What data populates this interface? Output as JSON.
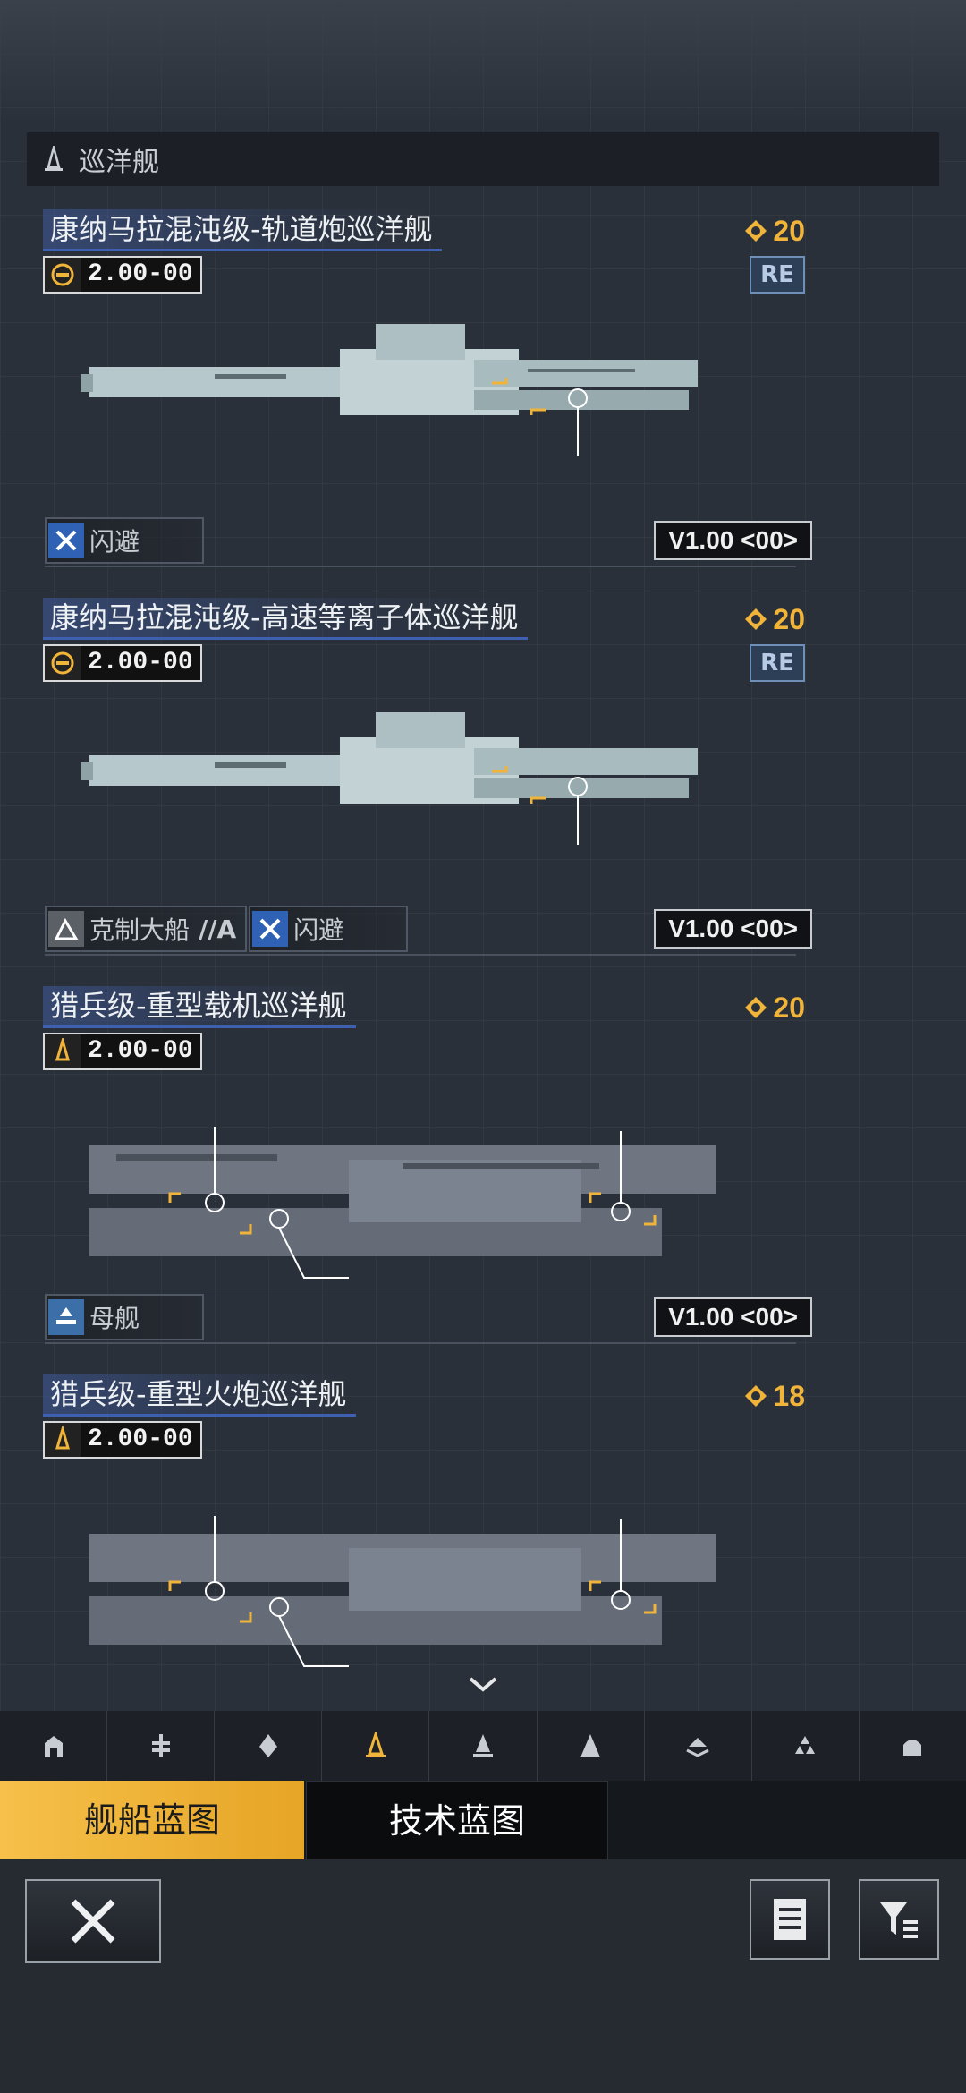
{
  "section": {
    "title": "巡洋舰"
  },
  "ships": [
    {
      "name": "康纳马拉混沌级-轨道炮巡洋舰",
      "cost": "20",
      "stat": "2.00-00",
      "badge": "RE",
      "tags": [
        {
          "label": "闪避",
          "icon": "dodge-icon"
        }
      ],
      "version": "V1.00 <00>"
    },
    {
      "name": "康纳马拉混沌级-高速等离子体巡洋舰",
      "cost": "20",
      "stat": "2.00-00",
      "badge": "RE",
      "tags": [
        {
          "label": "克制大船",
          "suffix": "//A",
          "icon": "counter-large-icon"
        },
        {
          "label": "闪避",
          "icon": "dodge-icon"
        }
      ],
      "version": "V1.00 <00>"
    },
    {
      "name": "猎兵级-重型载机巡洋舰",
      "cost": "20",
      "stat": "2.00-00",
      "tags": [
        {
          "label": "母舰",
          "icon": "carrier-icon"
        }
      ],
      "version": "V1.00 <00>"
    },
    {
      "name": "猎兵级-重型火炮巡洋舰",
      "cost": "18",
      "stat": "2.00-00"
    }
  ],
  "categories": [
    "fighter-icon",
    "corvette-icon",
    "frigate-icon",
    "cruiser-icon",
    "destroyer-icon",
    "battlecruiser-icon",
    "carrier-icon",
    "battleship-icon",
    "auxiliary-icon"
  ],
  "active_category": "cruiser-icon",
  "tabs": {
    "ship_blueprint": "舰船蓝图",
    "tech_blueprint": "技术蓝图"
  },
  "colors": {
    "accent": "#f0b43a",
    "tab_active": "#f6c04a",
    "name_underline": "#3f5fb0",
    "badge": "#6f8fb8"
  }
}
